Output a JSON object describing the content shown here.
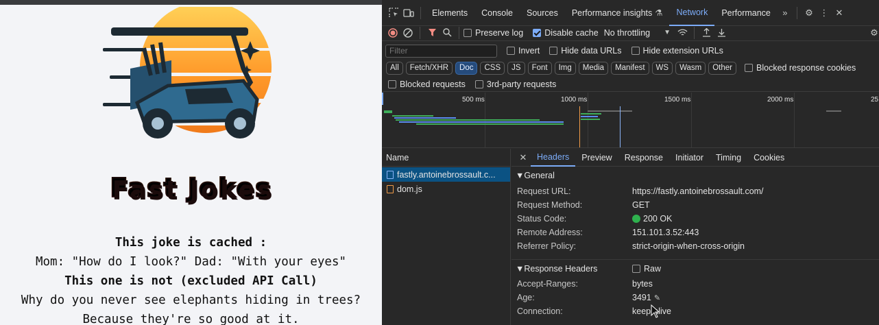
{
  "page": {
    "brand": "Fast Jokes",
    "jokes": [
      {
        "text": "This joke is cached :",
        "bold": true
      },
      {
        "text": "Mom: \"How do I look?\" Dad: \"With your eyes\"",
        "bold": false
      },
      {
        "text": "This one is not (excluded API Call)",
        "bold": true
      },
      {
        "text": "Why do you never see elephants hiding in trees?",
        "bold": false
      },
      {
        "text": "Because they're so good at it.",
        "bold": false
      }
    ]
  },
  "devtools": {
    "tabs": [
      "Elements",
      "Console",
      "Sources",
      "Performance insights",
      "Network",
      "Performance"
    ],
    "active_tab": "Network",
    "toolbar": {
      "preserve_log": "Preserve log",
      "disable_cache": "Disable cache",
      "throttling": "No throttling"
    },
    "filter": {
      "placeholder": "Filter",
      "invert": "Invert",
      "hide_data_urls": "Hide data URLs",
      "hide_extension_urls": "Hide extension URLs"
    },
    "type_filters": [
      "All",
      "Fetch/XHR",
      "Doc",
      "CSS",
      "JS",
      "Font",
      "Img",
      "Media",
      "Manifest",
      "WS",
      "Wasm",
      "Other"
    ],
    "active_type": "Doc",
    "blocked_response_cookies": "Blocked response cookies",
    "blocked_requests": "Blocked requests",
    "third_party_requests": "3rd-party requests",
    "timeline_labels": [
      "500 ms",
      "1000 ms",
      "1500 ms",
      "2000 ms",
      "25"
    ],
    "name_header": "Name",
    "requests": [
      {
        "name": "fastly.antoinebrossault.c...",
        "type": "doc"
      },
      {
        "name": "dom.js",
        "type": "js"
      }
    ],
    "detail_tabs": [
      "Headers",
      "Preview",
      "Response",
      "Initiator",
      "Timing",
      "Cookies"
    ],
    "active_detail_tab": "Headers",
    "general_title": "▼General",
    "general": [
      {
        "k": "Request URL:",
        "v": "https://fastly.antoinebrossault.com/"
      },
      {
        "k": "Request Method:",
        "v": "GET"
      },
      {
        "k": "Status Code:",
        "v": "200 OK"
      },
      {
        "k": "Remote Address:",
        "v": "151.101.3.52:443"
      },
      {
        "k": "Referrer Policy:",
        "v": "strict-origin-when-cross-origin"
      }
    ],
    "response_title": "▼Response Headers",
    "raw_label": "Raw",
    "response_headers": [
      {
        "k": "Accept-Ranges:",
        "v": "bytes"
      },
      {
        "k": "Age:",
        "v": "3491"
      },
      {
        "k": "Connection:",
        "v": "keep-alive"
      }
    ],
    "colors": {
      "accent": "#7cacf8",
      "selected_row": "#0b5283",
      "status_ok": "#2fb14e"
    }
  }
}
